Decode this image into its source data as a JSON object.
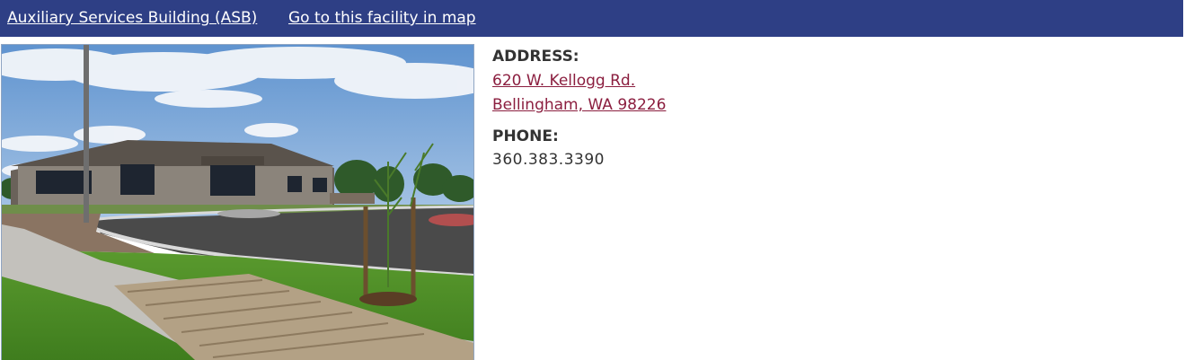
{
  "header": {
    "facility_name": "Auxiliary Services Building (ASB)",
    "map_link": "Go to this facility in map"
  },
  "photo": {
    "icon": "building-photo"
  },
  "details": {
    "address_label": "ADDRESS:",
    "address_line1": "620 W. Kellogg Rd.",
    "address_line2": "Bellingham, WA 98226",
    "phone_label": "PHONE:",
    "phone_value": "360.383.3390"
  },
  "colors": {
    "header_bg": "#2e3f85",
    "link_color": "#8b1e3f",
    "text_color": "#333333"
  }
}
